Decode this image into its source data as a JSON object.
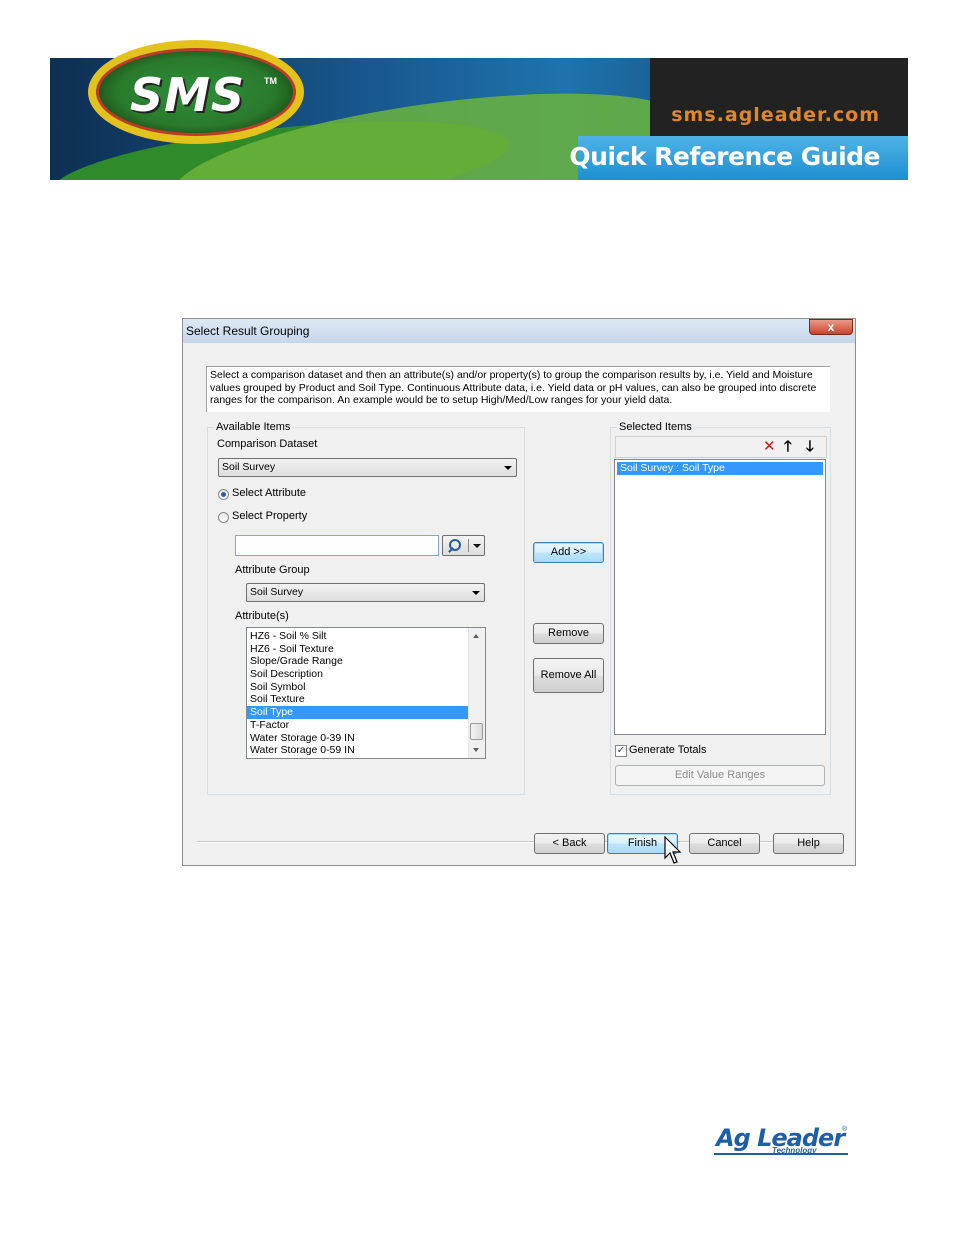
{
  "banner": {
    "logo_text": "SMS",
    "trademark": "TM",
    "url": "sms.agleader.com",
    "guide_title": "Quick Reference Guide"
  },
  "dialog": {
    "title": "Select Result Grouping",
    "close_glyph": "x",
    "instructions": "Select a comparison dataset and then an attribute(s) and/or property(s) to group the comparison results by, i.e. Yield and Moisture values grouped by Product and Soil Type.  Continuous Attribute data, i.e. Yield data or pH values, can also be grouped into discrete ranges for the comparison.  An example would be to setup High/Med/Low ranges for your yield data.",
    "available": {
      "group_label": "Available Items",
      "comparison_label": "Comparison Dataset",
      "comparison_value": "Soil Survey",
      "radio_attribute": "Select Attribute",
      "radio_property": "Select Property",
      "search_value": "",
      "attribute_group_label": "Attribute Group",
      "attribute_group_value": "Soil Survey",
      "attributes_label": "Attribute(s)",
      "attributes": [
        "HZ6 - Soil % Silt",
        "HZ6 - Soil Texture",
        "Slope/Grade Range",
        "Soil Description",
        "Soil Symbol",
        "Soil Texture",
        "Soil Type",
        "T-Factor",
        "Water Storage 0-39 IN",
        "Water Storage 0-59 IN"
      ],
      "selected_attribute": "Soil Type"
    },
    "middle": {
      "add": "Add >>",
      "remove": "Remove",
      "remove_all": "Remove All"
    },
    "selected": {
      "group_label": "Selected Items",
      "items": [
        "Soil Survey : Soil Type"
      ],
      "generate_totals": "Generate Totals",
      "generate_totals_checked": true,
      "edit_value_ranges": "Edit Value Ranges"
    },
    "footer": {
      "back": "< Back",
      "finish": "Finish",
      "cancel": "Cancel",
      "help": "Help"
    }
  },
  "brand": {
    "ag_leader": "Ag Leader",
    "technology": "Technology",
    "registered": "®"
  },
  "colors": {
    "selection": "#3399ff",
    "url_orange": "#e0872a",
    "guide_blue": "#1c8fd0",
    "ag_blue": "#1f5fa8"
  }
}
